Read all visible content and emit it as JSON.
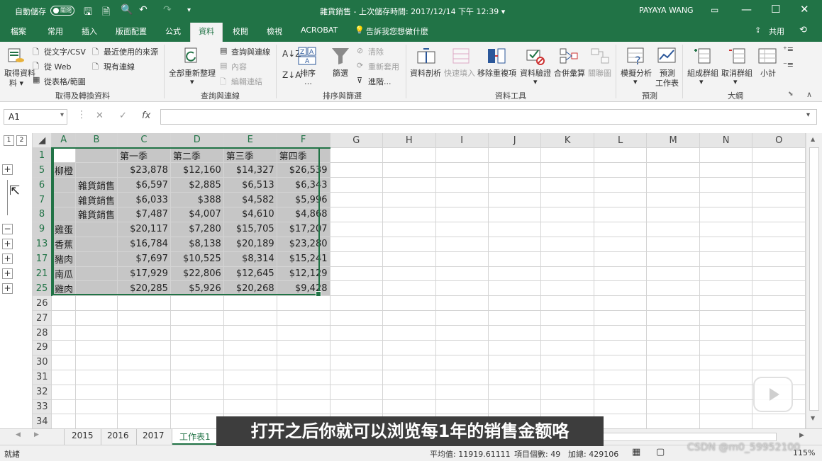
{
  "titlebar": {
    "autosave_label": "自動儲存",
    "autosave_state": "關閉",
    "doc_title": "雜貨銷售 - 上次儲存時間: 2017/12/14 下午 12:39 ▾",
    "user": "PAYAYA WANG",
    "qat_more": "▾"
  },
  "tabs": [
    "檔案",
    "常用",
    "插入",
    "版面配置",
    "公式",
    "資料",
    "校閱",
    "檢視",
    "ACROBAT"
  ],
  "tellme": "告訴我您想做什麼",
  "share": "共用",
  "ribbon": {
    "get_data": "取得資料",
    "get_data2": "料 ▾",
    "from_text": "從文字/CSV",
    "from_web": "從 Web",
    "from_table": "從表格/範圍",
    "recent": "最近使用的來源",
    "existing": "現有連線",
    "group1": "取得及轉換資料",
    "refresh_all": "全部重新整理",
    "queries_conn": "查詢與連線",
    "properties": "內容",
    "edit_links": "編輯連結",
    "group2": "查詢與連線",
    "sort": "排序",
    "filter": "篩選",
    "clear": "清除",
    "reapply": "重新套用",
    "advanced": "進階...",
    "group3": "排序與篩選",
    "text_to_cols": "資料剖析",
    "flash_fill": "快速填入",
    "remove_dup": "移除重複項",
    "validation": "資料驗證",
    "consolidate": "合併彙算",
    "relationships": "關聯圖",
    "group4": "資料工具",
    "whatif": "模擬分析",
    "forecast": "預測",
    "forecast2": "工作表",
    "group5": "預測",
    "group_btn": "組成群組",
    "ungroup": "取消群組",
    "subtotal": "小計",
    "group6": "大綱"
  },
  "formula_bar": {
    "name_box": "A1",
    "cancel": "✕",
    "enter": "✓",
    "fx": "fx",
    "formula": ""
  },
  "outline_levels": [
    "1",
    "2"
  ],
  "columns": [
    "A",
    "B",
    "C",
    "D",
    "E",
    "F",
    "G",
    "H",
    "I",
    "J",
    "K",
    "L",
    "M",
    "N",
    "O"
  ],
  "rows": [
    {
      "num": "1",
      "outline": "",
      "cells": [
        "",
        "",
        "第一季",
        "第二季",
        "第三季",
        "第四季"
      ]
    },
    {
      "num": "5",
      "outline": "+",
      "cells": [
        "柳橙",
        "",
        "$23,878",
        "$12,160",
        "$14,327",
        "$26,539"
      ]
    },
    {
      "num": "6",
      "outline": "",
      "cells": [
        "",
        "雜貨銷售",
        "$6,597",
        "$2,885",
        "$6,513",
        "$6,343"
      ]
    },
    {
      "num": "7",
      "outline": "",
      "cells": [
        "",
        "雜貨銷售",
        "$6,033",
        "$388",
        "$4,582",
        "$5,996"
      ]
    },
    {
      "num": "8",
      "outline": "",
      "cells": [
        "",
        "雜貨銷售",
        "$7,487",
        "$4,007",
        "$4,610",
        "$4,868"
      ]
    },
    {
      "num": "9",
      "outline": "−",
      "cells": [
        "雞蛋",
        "",
        "$20,117",
        "$7,280",
        "$15,705",
        "$17,207"
      ]
    },
    {
      "num": "13",
      "outline": "+",
      "cells": [
        "香蕉",
        "",
        "$16,784",
        "$8,138",
        "$20,189",
        "$23,280"
      ]
    },
    {
      "num": "17",
      "outline": "+",
      "cells": [
        "豬肉",
        "",
        "$7,697",
        "$10,525",
        "$8,314",
        "$15,241"
      ]
    },
    {
      "num": "21",
      "outline": "+",
      "cells": [
        "南瓜",
        "",
        "$17,929",
        "$22,806",
        "$12,645",
        "$12,129"
      ]
    },
    {
      "num": "25",
      "outline": "+",
      "cells": [
        "雞肉",
        "",
        "$20,285",
        "$5,926",
        "$20,268",
        "$9,428"
      ]
    },
    {
      "num": "26",
      "outline": "",
      "cells": [
        "",
        "",
        "",
        "",
        "",
        ""
      ]
    },
    {
      "num": "27",
      "outline": "",
      "cells": [
        "",
        "",
        "",
        "",
        "",
        ""
      ]
    },
    {
      "num": "28",
      "outline": "",
      "cells": [
        "",
        "",
        "",
        "",
        "",
        ""
      ]
    },
    {
      "num": "29",
      "outline": "",
      "cells": [
        "",
        "",
        "",
        "",
        "",
        ""
      ]
    },
    {
      "num": "30",
      "outline": "",
      "cells": [
        "",
        "",
        "",
        "",
        "",
        ""
      ]
    },
    {
      "num": "31",
      "outline": "",
      "cells": [
        "",
        "",
        "",
        "",
        "",
        ""
      ]
    },
    {
      "num": "32",
      "outline": "",
      "cells": [
        "",
        "",
        "",
        "",
        "",
        ""
      ]
    },
    {
      "num": "33",
      "outline": "",
      "cells": [
        "",
        "",
        "",
        "",
        "",
        ""
      ]
    },
    {
      "num": "34",
      "outline": "",
      "cells": [
        "",
        "",
        "",
        "",
        "",
        ""
      ]
    }
  ],
  "sheet_tabs": [
    "2015",
    "2016",
    "2017",
    "工作表1"
  ],
  "active_sheet": "工作表1",
  "status": {
    "ready": "就緒",
    "average": "平均值: 11919.61111",
    "count": "項目個數: 49",
    "sum": "加總: 429106",
    "zoom": "115%"
  },
  "subtitle": "打开之后你就可以浏览每1年的销售金额咯",
  "watermark": "CSDN @m0_59952100",
  "colors": {
    "accent": "#217346",
    "selection": "#c6c6c6"
  }
}
